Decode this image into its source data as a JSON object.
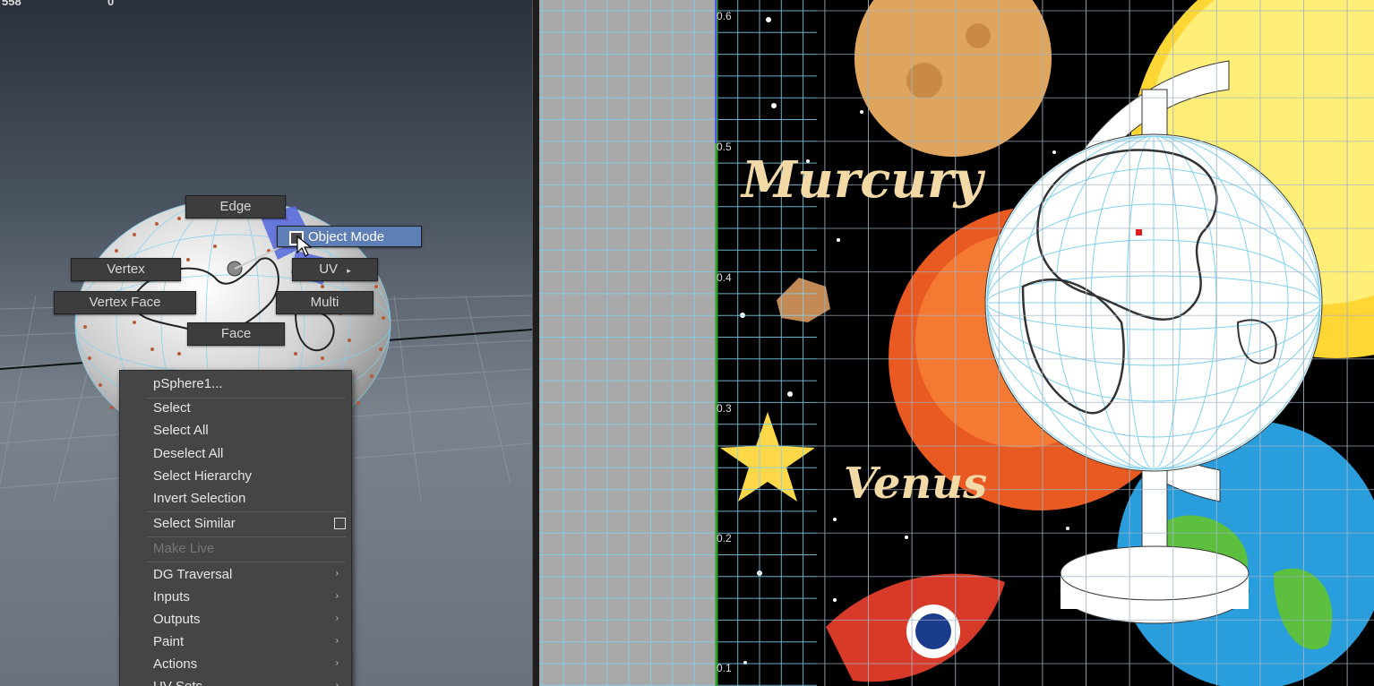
{
  "viewport": {
    "hud": [
      "558",
      "0"
    ]
  },
  "marking_menu": {
    "edge": "Edge",
    "object_mode": "Object Mode",
    "vertex": "Vertex",
    "uv": "UV",
    "vertex_face": "Vertex Face",
    "multi": "Multi",
    "face": "Face"
  },
  "context_menu": {
    "header": "pSphere1...",
    "items": [
      "Select",
      "Select All",
      "Deselect All",
      "Select Hierarchy",
      "Invert Selection"
    ],
    "select_similar": "Select Similar",
    "make_live": "Make Live",
    "submenus": [
      "DG Traversal",
      "Inputs",
      "Outputs",
      "Paint",
      "Actions",
      "UV Sets"
    ]
  },
  "uv_editor": {
    "axis_labels": [
      "0.6",
      "0.5",
      "0.4",
      "0.3",
      "0.2",
      "0.1"
    ],
    "texture_text": {
      "mercury": "Murcury",
      "venus": "Venus"
    }
  },
  "colors": {
    "grid_line": "#7fd0ee",
    "menu_bg": "#454545",
    "active_button": "#5d7fb6",
    "uv_border": "#2aa02a"
  }
}
